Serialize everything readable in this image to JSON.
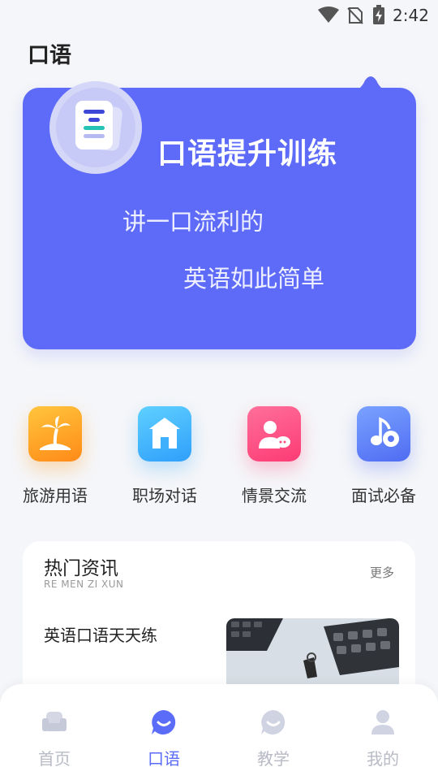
{
  "status_bar": {
    "time": "2:42"
  },
  "page": {
    "title": "口语"
  },
  "hero": {
    "title": "口语提升训练",
    "line1": "讲一口流利的",
    "line2": "英语如此简单"
  },
  "categories": [
    {
      "label": "旅游用语",
      "icon": "palm-tree-icon",
      "color": "#ffa726"
    },
    {
      "label": "职场对话",
      "icon": "building-icon",
      "color": "#3fb0fc"
    },
    {
      "label": "情景交流",
      "icon": "chat-person-icon",
      "color": "#fc4a7e"
    },
    {
      "label": "面试必备",
      "icon": "music-note-icon",
      "color": "#5a78f5"
    }
  ],
  "news": {
    "title": "热门资讯",
    "subtitle": "RE MEN ZI XUN",
    "more": "更多",
    "items": [
      {
        "title": "英语口语天天练"
      }
    ]
  },
  "bottom_nav": [
    {
      "label": "首页",
      "icon": "sofa-icon",
      "active": false
    },
    {
      "label": "口语",
      "icon": "chat-bubble-icon",
      "active": true
    },
    {
      "label": "教学",
      "icon": "chat-bubble-icon",
      "active": false
    },
    {
      "label": "我的",
      "icon": "person-icon",
      "active": false
    }
  ],
  "colors": {
    "accent": "#5e6bf8",
    "nav_inactive": "#b8bbc6"
  }
}
